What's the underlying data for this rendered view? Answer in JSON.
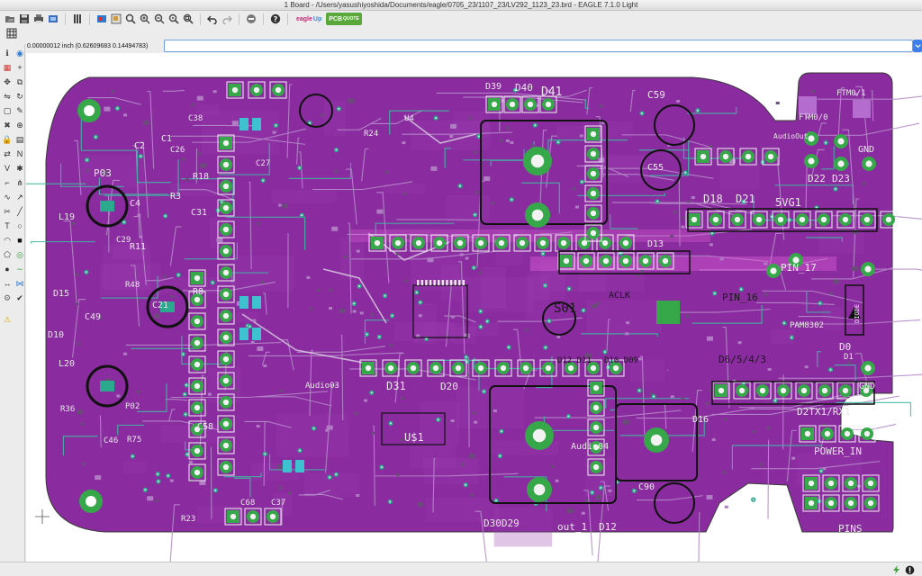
{
  "window": {
    "title": "1 Board - /Users/yasushiyoshida/Documents/eagle/0705_23/1107_23/LV292_1123_23.brd - EAGLE 7.1.0 Light"
  },
  "toolbar": {
    "icons": [
      "open-icon",
      "save-icon",
      "print-icon",
      "cam-icon",
      "grid-icon",
      "layers-icon",
      "window-select-icon",
      "zoom-fit-icon",
      "zoom-in-icon",
      "zoom-out-icon",
      "zoom-previous-icon",
      "zoom-window-icon",
      "undo-icon",
      "redo-icon",
      "stop-icon",
      "help-icon"
    ],
    "eagle_up_label": "eagle",
    "eagle_up_sub": "Up",
    "pcb_quote_label": "PCB",
    "pcb_quote_sub": "QUOTE"
  },
  "command": {
    "coordinates": "0.00000012 inch (0.62609683 0.14494783)",
    "value": "",
    "placeholder": ""
  },
  "leftbar": {
    "tools": [
      "info-icon",
      "show-icon",
      "display-icon",
      "mark-icon",
      "move-icon",
      "copy-icon",
      "mirror-icon",
      "rotate-icon",
      "group-icon",
      "change-icon",
      "delete-icon",
      "add-icon",
      "lock-icon",
      "paste-icon",
      "replace-icon",
      "name-icon",
      "value-icon",
      "smash-icon",
      "miter-icon",
      "split-icon",
      "optimize-icon",
      "route-icon",
      "ripup-icon",
      "wire-icon",
      "text-icon",
      "circle-icon",
      "arc-icon",
      "rect-icon",
      "polygon-icon",
      "via-icon",
      "hole-icon",
      "signal-icon",
      "dimension-icon",
      "ratsnest-icon",
      "autorouter-icon",
      "drc-icon",
      "errors-icon"
    ]
  },
  "board": {
    "colors": {
      "background": "#ffffff",
      "board": "#8a2b9f",
      "copper": "#7b1fa0",
      "pad": "#37a84a",
      "via": "#2aa98e",
      "silk": "#e8e8e8",
      "text_dark": "#111111"
    },
    "labels": {
      "c59": "C59",
      "d40": "D40",
      "d41": "D41",
      "d39": "D39",
      "c55": "C55",
      "ftm0_1": "FTM0/1",
      "ftm0_0": "FTM0/0",
      "gnd_top": "GND",
      "p03": "P03",
      "c1": "C1",
      "c2": "C2",
      "c4": "C4",
      "r3": "R3",
      "r18": "R18",
      "c31": "C31",
      "l19": "L19",
      "r11": "R11",
      "d18": "D18",
      "d21": "D21",
      "d22": "D22",
      "d23": "D23",
      "svg1": "5VG1",
      "d13": "D13",
      "audiout": "AudioOut",
      "c21": "C21",
      "r8": "R8",
      "d15": "D15",
      "c49": "C49",
      "d10": "D10",
      "l20": "L20",
      "p02": "P02",
      "s01": "S01",
      "aclk": "ACLK",
      "pin_17": "PIN_17",
      "pin_16": "PIN_16",
      "d6543": "D6/5/4/3",
      "gnd_mid": "GND",
      "d31": "D31",
      "d20": "D20",
      "audio03": "Audio03",
      "d12d11": "D12 D11",
      "d10d09": "D10 D09",
      "d2tx1rx1": "D2TX1/RX1",
      "power_in": "POWER_IN",
      "u1": "U$1",
      "audio04": "Audio04",
      "c90": "C90",
      "d30d29": "D30D29",
      "out_1": "out_1",
      "d12b": "D12",
      "pins": "PINS",
      "c58": "C58",
      "c46": "C46",
      "r75": "R75",
      "c37": "C37",
      "d1_vert": "DIODE",
      "pam": "PAM8302",
      "d0": "D0",
      "c68": "C68",
      "r36": "R36",
      "r23": "R23",
      "c38": "C38",
      "c26": "C26",
      "c27": "C27",
      "d16": "D16",
      "r48": "R48",
      "d1": "D1",
      "u4": "U4",
      "r24": "R24",
      "c29": "C29"
    }
  },
  "statusbar": {
    "icons": [
      "go-icon",
      "stop-icon"
    ]
  }
}
